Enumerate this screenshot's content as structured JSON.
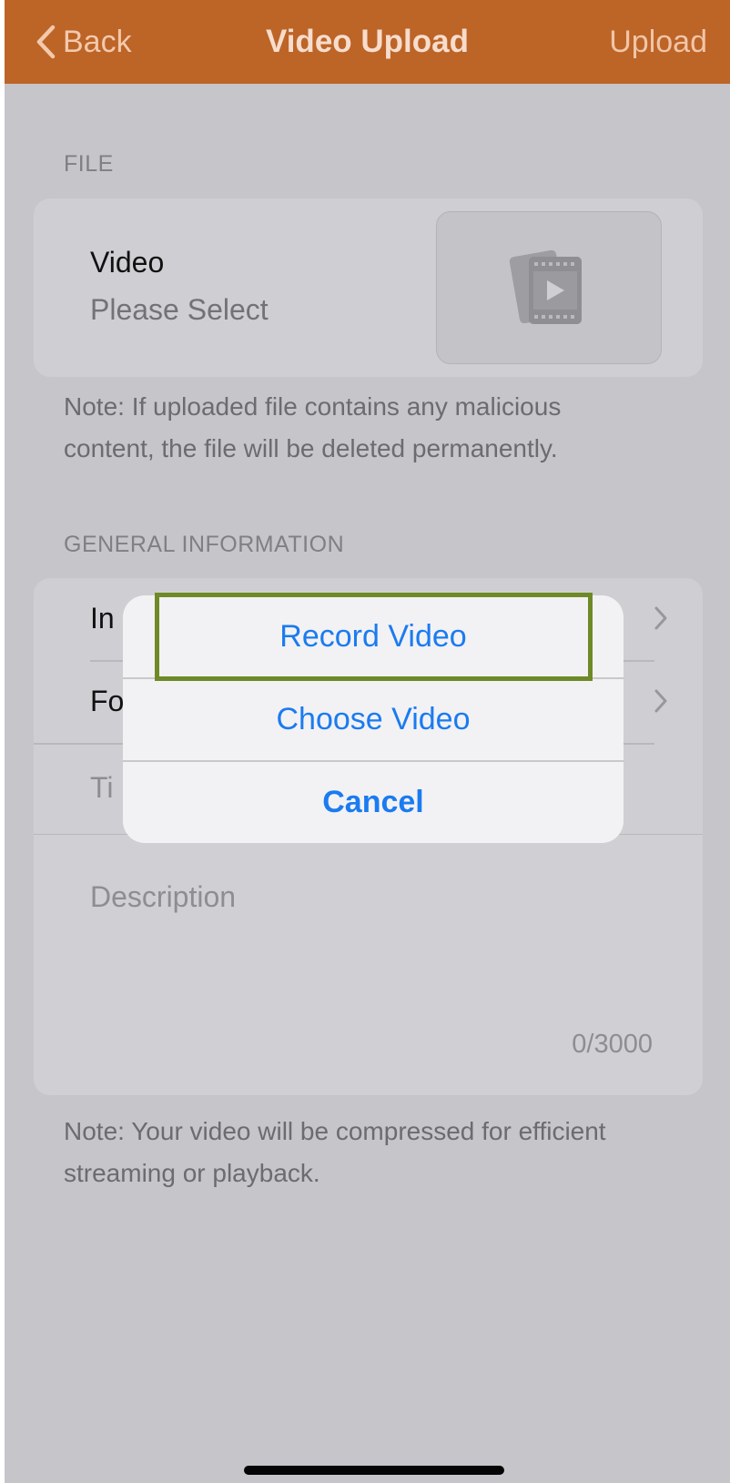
{
  "nav": {
    "back_label": "Back",
    "title": "Video Upload",
    "upload_label": "Upload",
    "color": "#bd6427"
  },
  "file_section": {
    "header": "FILE",
    "label": "Video",
    "value": "Please Select",
    "thumbnail_icon": "video-gallery-icon",
    "note": "Note: If uploaded file contains any malicious content, the file will be deleted permanently."
  },
  "general_section": {
    "header": "GENERAL INFORMATION",
    "rows": [
      {
        "label_visible": "In",
        "chevron": true
      },
      {
        "label_visible": "Fo",
        "chevron": true
      },
      {
        "label_visible": "Ti",
        "chevron": false
      }
    ],
    "description_placeholder": "Description",
    "description_counter": "0/3000",
    "note": "Note: Your video will be compressed for efficient streaming or playback."
  },
  "action_sheet": {
    "record_label": "Record Video",
    "choose_label": "Choose Video",
    "cancel_label": "Cancel",
    "button_color": "#1b7bf0",
    "highlight_color": "#6e8a27"
  }
}
